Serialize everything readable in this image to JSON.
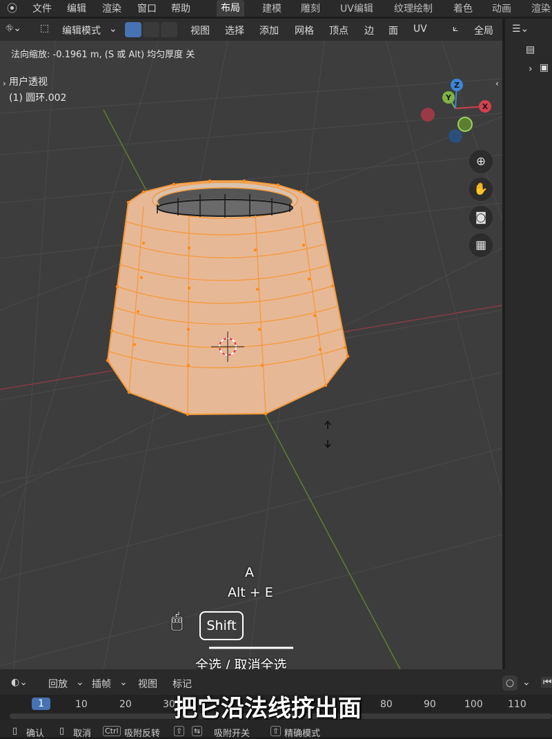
{
  "menubar": {
    "items": [
      "文件",
      "编辑",
      "渲染",
      "窗口",
      "帮助"
    ],
    "workspaces": [
      "布局",
      "建模",
      "雕刻",
      "UV编辑",
      "纹理绘制",
      "着色",
      "动画",
      "渲染"
    ],
    "active_workspace": "布局"
  },
  "viewport_header": {
    "mode": "编辑模式",
    "menus": [
      "视图",
      "选择",
      "添加",
      "网格",
      "顶点",
      "边",
      "面",
      "UV"
    ],
    "transform_orientation": "全局"
  },
  "operator_info": "法向缩放: -0.1961 m, (S 或 Alt) 均匀厚度 关",
  "view_info": {
    "view_name": "用户透视",
    "object_name": "(1) 圆环.002"
  },
  "gizmo": {
    "x": "X",
    "y": "Y",
    "z": "Z"
  },
  "keycast": {
    "keys_line1": "A",
    "keys_line2": "Alt + E",
    "modifier": "Shift",
    "action": "全选 / 取消全选"
  },
  "subtitle": "把它沿法线挤出面",
  "timeline": {
    "playback": "回放",
    "keying": "插帧",
    "view": "视图",
    "marker": "标记",
    "current_frame": "1",
    "frames": [
      "10",
      "20",
      "30",
      "80",
      "90",
      "100",
      "110"
    ]
  },
  "statusbar": {
    "confirm": "确认",
    "cancel": "取消",
    "ctrl_key": "Ctrl",
    "snap_invert": "吸附反转",
    "snap_toggle": "吸附开关",
    "precision": "精确模式"
  },
  "colors": {
    "selected_mesh": "#e6b896",
    "edge_select": "#f59a3a",
    "axis_x": "#d6404e",
    "axis_y": "#7fb443",
    "axis_z": "#3b86d6",
    "active_button": "#4772b3"
  }
}
